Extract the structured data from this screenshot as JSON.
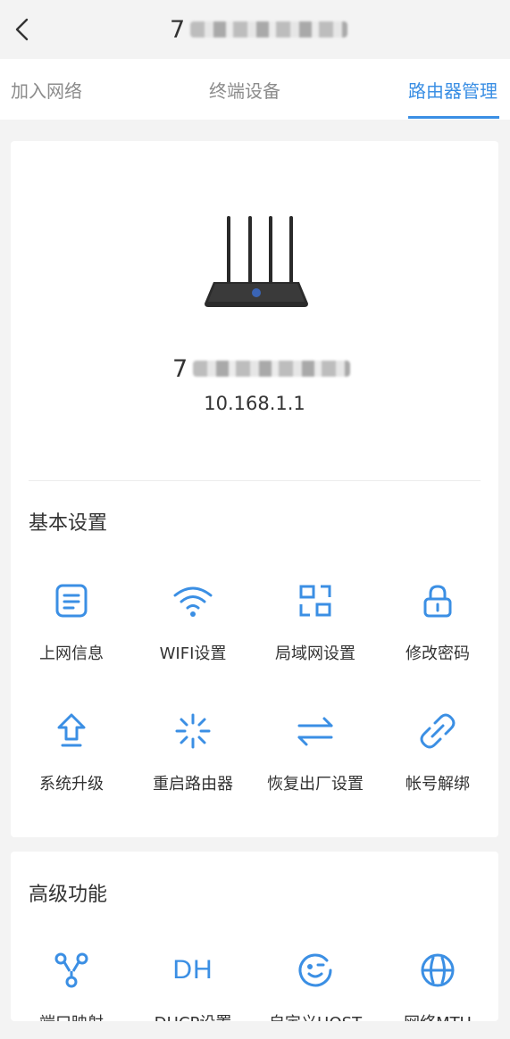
{
  "header": {
    "title_prefix": "7",
    "back_icon": "chevron-left-icon"
  },
  "tabs": [
    {
      "label": "加入网络",
      "active": false
    },
    {
      "label": "终端设备",
      "active": false
    },
    {
      "label": "路由器管理",
      "active": true
    }
  ],
  "router": {
    "name_prefix": "7",
    "ip": "10.168.1.1",
    "image": "router-icon"
  },
  "basic": {
    "title": "基本设置",
    "items": [
      {
        "label": "上网信息",
        "icon": "document-icon"
      },
      {
        "label": "WIFI设置",
        "icon": "wifi-icon"
      },
      {
        "label": "局域网设置",
        "icon": "lan-icon"
      },
      {
        "label": "修改密码",
        "icon": "lock-icon"
      },
      {
        "label": "系统升级",
        "icon": "upgrade-icon"
      },
      {
        "label": "重启路由器",
        "icon": "restart-icon"
      },
      {
        "label": "恢复出厂设置",
        "icon": "swap-icon"
      },
      {
        "label": "帐号解绑",
        "icon": "unlink-icon"
      }
    ]
  },
  "advanced": {
    "title": "高级功能",
    "items": [
      {
        "label": "端口映射",
        "icon": "port-mapping-icon"
      },
      {
        "label": "DHCP设置",
        "icon": "dhcp-icon",
        "icon_text": "DH"
      },
      {
        "label": "自定义HOST",
        "icon": "host-icon"
      },
      {
        "label": "网络MTU",
        "icon": "mtu-icon"
      }
    ]
  },
  "accent_color": "#3b8fe4"
}
